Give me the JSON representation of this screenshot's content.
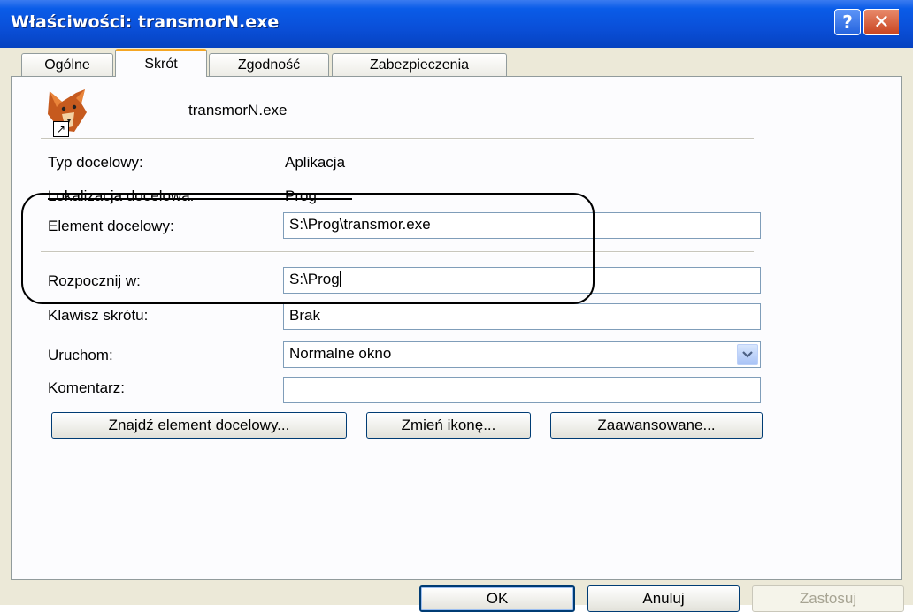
{
  "window": {
    "title": "Właściwości: transmorN.exe"
  },
  "tabs": [
    "Ogólne",
    "Skrót",
    "Zgodność",
    "Zabezpieczenia"
  ],
  "app": {
    "name": "transmorN.exe",
    "icon": "fox-icon"
  },
  "props": {
    "target_type": {
      "label": "Typ docelowy:",
      "value": "Aplikacja"
    },
    "target_location": {
      "label": "Lokalizacja docelowa:",
      "value": "Prog"
    },
    "target": {
      "label": "Element docelowy:",
      "value": "S:\\Prog\\transmor.exe"
    },
    "start_in": {
      "label": "Rozpocznij w:",
      "value": "S:\\Prog"
    },
    "shortcut_key": {
      "label": "Klawisz skrótu:",
      "value": "Brak"
    },
    "run": {
      "label": "Uruchom:",
      "value": "Normalne okno"
    },
    "comment": {
      "label": "Komentarz:",
      "value": ""
    }
  },
  "buttons": {
    "find_target": "Znajdź element docelowy...",
    "change_icon": "Zmień ikonę...",
    "advanced": "Zaawansowane...",
    "ok": "OK",
    "cancel": "Anuluj",
    "apply": "Zastosuj"
  },
  "colors": {
    "titlebar": "#0a4fd8",
    "dialog": "#ece9d8",
    "tab_highlight": "#f5a623"
  }
}
